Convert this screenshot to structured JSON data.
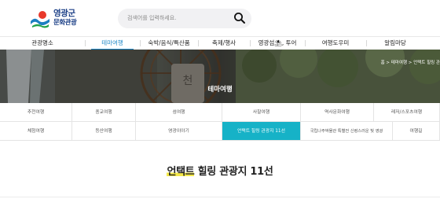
{
  "header": {
    "logo": {
      "line1": "영광군",
      "line2": "문화관광"
    },
    "search": {
      "placeholder": "검색어를 입력하세요."
    }
  },
  "nav": {
    "items": [
      {
        "label": "관광명소",
        "active": false
      },
      {
        "label": "테마여행",
        "active": true
      },
      {
        "label": "숙박/음식/특산품",
        "active": false
      },
      {
        "label": "축제/행사",
        "active": false
      },
      {
        "label": "영광섬⛱, 투어",
        "active": false
      },
      {
        "label": "여행도우미",
        "active": false
      },
      {
        "label": "알림마당",
        "active": false
      }
    ],
    "active_color": "#1e88c8"
  },
  "banner": {
    "title": "테마여행",
    "breadcrumb": "홈 > 테마여행 > 언택트 힐링 관"
  },
  "submenu": {
    "row1": [
      "추천여행",
      "종교여행",
      "섬여행",
      "사찰여행",
      "역사문화여행",
      "레저/스포츠여행"
    ],
    "row2": [
      "체험여행",
      "등산여행",
      "영광이야기",
      "언택트 힐링 관광지 11선",
      "국립나주박물관 특별전 신령스러운 빛 영광",
      "여행길"
    ],
    "active": "언택트 힐링 관광지 11선",
    "active_color": "#16b2c7"
  },
  "page": {
    "title_highlight": "언택트",
    "title_rest": " 힐링 관광지 11선"
  }
}
